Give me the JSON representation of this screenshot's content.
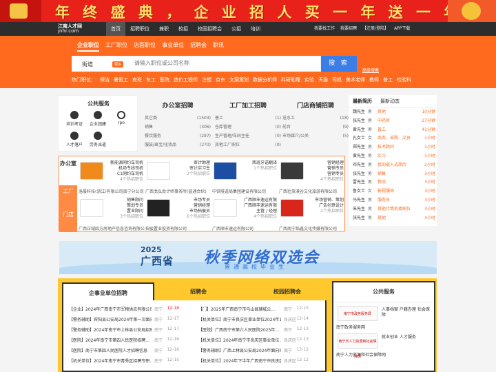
{
  "banner": {
    "slogan": "年 终 盛 典 ， 企 业 招 人 买 一 年 送 一 年 ！"
  },
  "nav": {
    "logo_title": "江南人才网",
    "logo_url": "jnhr.com",
    "items": [
      "首页",
      "招聘职位",
      "兼职",
      "校招",
      "校园招聘会",
      "公招",
      "培训"
    ],
    "right": [
      "我要找工作",
      "我要招聘",
      "【注册/登陆】",
      "APP下载"
    ]
  },
  "search": {
    "tabs": [
      "企业职位",
      "工厂职位",
      "店面职位",
      "事业单位",
      "招聘会",
      "职讯"
    ],
    "city": "街道",
    "change": "更多",
    "placeholder": "请输入职位或公司名称",
    "button": "搜 索",
    "advanced": "高级搜索",
    "hot_label": "热门职位：",
    "hot": [
      "保洁",
      "暑假工",
      "夜班",
      "车工",
      "医院",
      "造价工程师",
      "注塑",
      "京东",
      "文案策划",
      "数据分析师",
      "科研助理",
      "实验",
      "天猫",
      "司机",
      "美术老师",
      "教师",
      "普工",
      "检验科"
    ]
  },
  "public_service": {
    "title": "公共服务",
    "items": [
      "培训考证",
      "企业团建",
      "rpo",
      "人才落户",
      "劳务派遣"
    ]
  },
  "categories": [
    {
      "title": "办公室招聘",
      "rows": [
        [
          "其它类",
          "(1503)"
        ],
        [
          "销售",
          "(306)"
        ],
        [
          "餐饮服务",
          "(297)"
        ],
        [
          "服装/珠宝/化妆品",
          "(270)"
        ]
      ]
    },
    {
      "title": "工厂加工招聘",
      "rows": [
        [
          "普工",
          "(1)"
        ],
        [
          "仓库管理",
          "(0)"
        ],
        [
          "生产管理/车间主任",
          "(0)"
        ],
        [
          "其他工厂职位",
          "(0)"
        ]
      ]
    },
    {
      "title": "门店商铺招聘",
      "rows": [
        [
          "送水工",
          "(18)"
        ],
        [
          "前台",
          "(9)"
        ],
        [
          "市场媒介/公关",
          "(5)"
        ],
        [
          "",
          ""
        ]
      ]
    }
  ],
  "corp_side": [
    "办公室",
    "工厂",
    "门店"
  ],
  "companies": [
    {
      "jobs": [
        "新能源网约车司机",
        "机场专线司机",
        "C1网约车司机"
      ],
      "count": "4个热招职位",
      "name": "洛晨科技(浙江)有限公司南宁分公司",
      "logo": "#f08a1d"
    },
    {
      "jobs": [
        "审计助理",
        "审计实习生"
      ],
      "count": "2个热招职位",
      "name": "广西戈弘会计师事务所(普通合伙)",
      "logo": "#ffffff"
    },
    {
      "jobs": [
        "西班牙语翻译"
      ],
      "count": "1个热招职位",
      "name": "中铁隧道局集团建设有限公司",
      "logo": "#1c4ea3"
    },
    {
      "jobs": [
        "营销经理",
        "营销专员",
        "营销专员"
      ],
      "count": "4个热招职位",
      "name": "广西壮族漠谷文化旅游有限公司",
      "logo": "#3a3a3a"
    },
    {
      "jobs": [
        "销售顾问",
        "策划专员",
        "置业顾问"
      ],
      "count": "3个热招职位",
      "name": "广西正域四方房地产信息咨询有限公司",
      "logo": "#ffffff"
    },
    {
      "jobs": [
        "市场专员",
        "营销经理",
        "市场拓展员"
      ],
      "count": "6个热招职位",
      "name": "伯骏置业投资有限公司",
      "logo": "#222222"
    },
    {
      "jobs": [
        "广西顺丰速运有限",
        "广西顺丰速运有限",
        "主管 / 经理"
      ],
      "count": "4个热招职位",
      "name": "广西顺丰速运有限公司",
      "logo": "#ffffff"
    },
    {
      "jobs": [
        "市场营销、策划",
        "广告创意设计"
      ],
      "count": "2个热招职位",
      "name": "广西南宁焰鑫文化传媒有限公司",
      "logo": "#d8261c"
    }
  ],
  "news": {
    "tabs": [
      "最新简历",
      "最新动态"
    ],
    "rows": [
      [
        "魏先生",
        "男",
        "其他",
        "10分钟"
      ],
      [
        "张先生",
        "男",
        "中药房",
        "27分钟"
      ],
      [
        "黄先生",
        "男",
        "普工",
        "41分钟"
      ],
      [
        "孔女士",
        "女",
        "商务、采购、文员",
        "1小时"
      ],
      [
        "郑先生",
        "男",
        "技术顾问",
        "1小时"
      ],
      [
        "黄先生",
        "男",
        "实习",
        "1小时"
      ],
      [
        "邓先生",
        "男",
        "我的嵌入式简历",
        "2小时"
      ],
      [
        "张先生",
        "男",
        "销售",
        "3小时"
      ],
      [
        "雷先生",
        "男",
        "物流",
        "3小时"
      ],
      [
        "鲁女士",
        "女",
        "影视服饰",
        "3小时"
      ],
      [
        "马先生",
        "男",
        "服务员",
        "3小时"
      ],
      [
        "朱先生",
        "男",
        "其他计算机类职位",
        "3小时"
      ],
      [
        "张先生",
        "男",
        "其他",
        "4小时"
      ]
    ]
  },
  "ad": {
    "year": "2025",
    "province": "广西省",
    "title": "秋季网络双选会",
    "subtitle": "普通高校毕业生"
  },
  "bottom_tabs": [
    "企事业单位招聘",
    "招聘会",
    "校园招聘会"
  ],
  "job_cols": [
    [
      [
        "【企业】2024年广西南宁市军粮供应有限公司...",
        "南宁",
        "12-18"
      ],
      [
        "【警务辅助】宾阳县公安局2024年第一次面向...",
        "南宁",
        "12-17"
      ],
      [
        "【警务辅助】2024年南宁市上林县公安局招聘...",
        "南宁",
        "12-17"
      ],
      [
        "【医院】2024年南宁市第四人民医院招聘...",
        "南宁",
        "12-16"
      ],
      [
        "【医院】南宁市第四人民医院人才招聘信息",
        "南宁",
        "12-16"
      ],
      [
        "【机关单位】2024年南宁市青秀区招聘专职...",
        "南宁",
        "12-15"
      ]
    ],
    [
      [
        "【门】2025年广西南宁市马山县辅城公...",
        "南宁",
        "12-15"
      ],
      [
        "【机关单位】南宁市良庆区事业单位2024年12...",
        "良庆区",
        "12-14"
      ],
      [
        "【医院】广西南宁市第六人民医院2025年...",
        "南宁",
        "12-13"
      ],
      [
        "【机关单位】2024年南宁市良庆区事业单位...",
        "良庆区",
        "12-13"
      ],
      [
        "【警务辅助】广西上林县公安局2024年面向社...",
        "南宁",
        "12-12"
      ],
      [
        "【机关单位】2024年下半年广西南宁市良庆区...",
        "良庆区",
        "12-12"
      ]
    ]
  ],
  "services": {
    "title": "公共服务",
    "items": [
      {
        "logo": "南宁市政务服务局",
        "text": "人事档案 户籍办理 社会保障",
        "name": "南宁政务服务网"
      },
      {
        "logo": "南宁市人力资源和社会保障局",
        "text": "就业创业 人才服务",
        "name": "南宁人力资源和社会保障网"
      }
    ]
  }
}
